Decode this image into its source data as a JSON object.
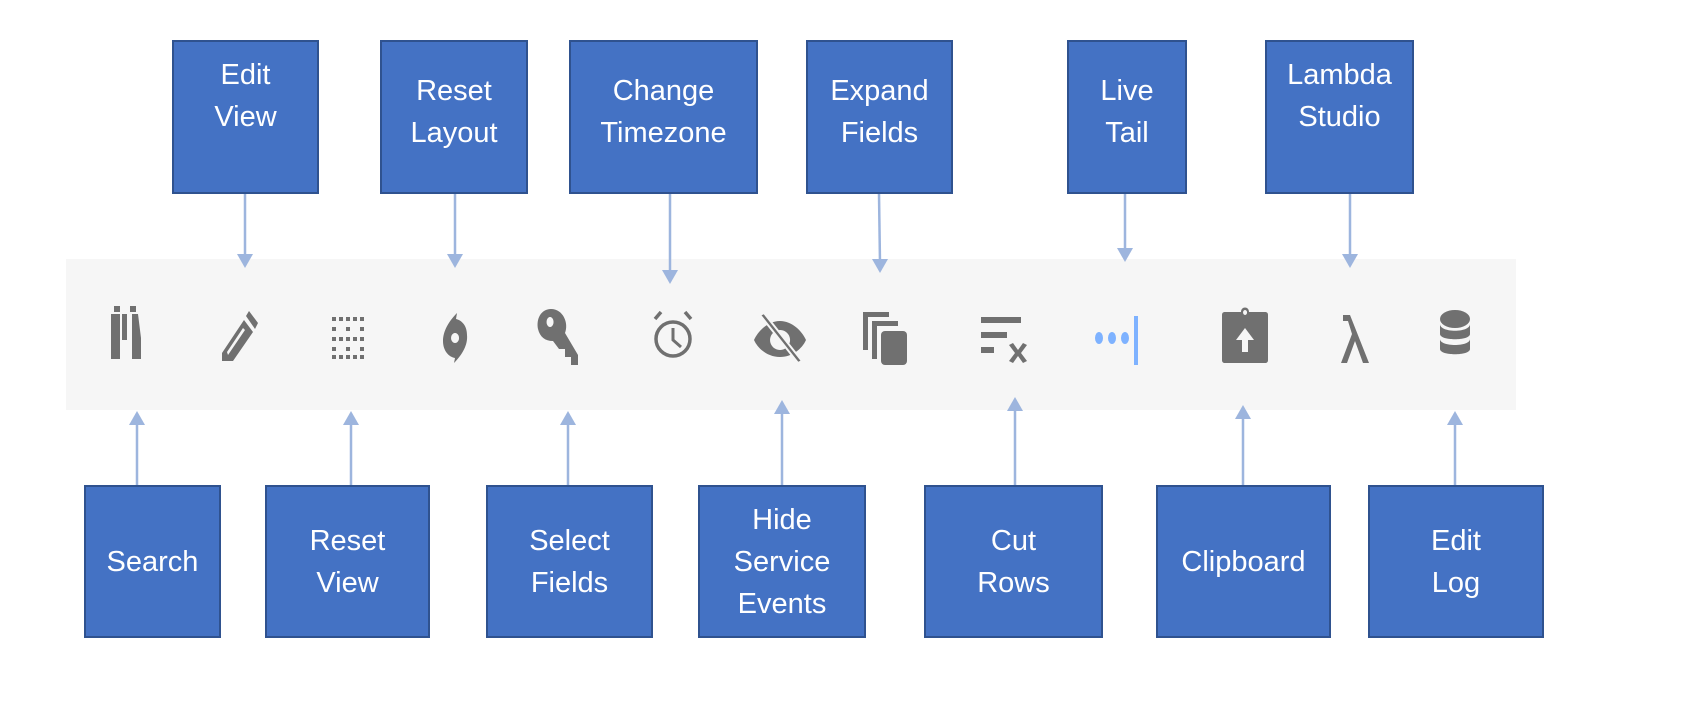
{
  "toolbar": {
    "icons": [
      {
        "name": "binoculars-icon",
        "action": "Search"
      },
      {
        "name": "pencil-icon",
        "action": "Edit View"
      },
      {
        "name": "dotted-grid-icon",
        "action": "Reset View"
      },
      {
        "name": "hurricane-icon",
        "action": "Reset Layout"
      },
      {
        "name": "key-icon",
        "action": "Select Fields"
      },
      {
        "name": "alarm-clock-icon",
        "action": "Change Timezone"
      },
      {
        "name": "eye-slash-icon",
        "action": "Hide Service Events"
      },
      {
        "name": "copy-stack-icon",
        "action": "Expand Fields"
      },
      {
        "name": "clear-rows-icon",
        "action": "Cut Rows"
      },
      {
        "name": "live-tail-icon",
        "action": "Live Tail"
      },
      {
        "name": "clipboard-upload-icon",
        "action": "Clipboard"
      },
      {
        "name": "lambda-icon",
        "action": "Lambda Studio"
      },
      {
        "name": "database-icon",
        "action": "Edit Log"
      }
    ],
    "icon_color": "#707070",
    "live_tail_color": "#7eb2ff"
  },
  "labels_top": [
    {
      "lines": [
        "Edit",
        "View"
      ]
    },
    {
      "lines": [
        "Reset",
        "Layout"
      ]
    },
    {
      "lines": [
        "Change",
        "Timezone"
      ]
    },
    {
      "lines": [
        "Expand",
        "Fields"
      ]
    },
    {
      "lines": [
        "Live",
        "Tail"
      ]
    },
    {
      "lines": [
        "Lambda",
        "Studio"
      ]
    }
  ],
  "labels_bottom": [
    {
      "lines": [
        "Search"
      ]
    },
    {
      "lines": [
        "Reset",
        "View"
      ]
    },
    {
      "lines": [
        "Select",
        "Fields"
      ]
    },
    {
      "lines": [
        "Hide",
        "Service",
        "Events"
      ]
    },
    {
      "lines": [
        "Cut",
        "Rows"
      ]
    },
    {
      "lines": [
        "Clipboard"
      ]
    },
    {
      "lines": [
        "Edit",
        "Log"
      ]
    }
  ],
  "colors": {
    "box": "#4472c4",
    "box_border": "#2f528f",
    "arrow": "#9db5de",
    "toolbar_bg": "#f6f6f6"
  }
}
